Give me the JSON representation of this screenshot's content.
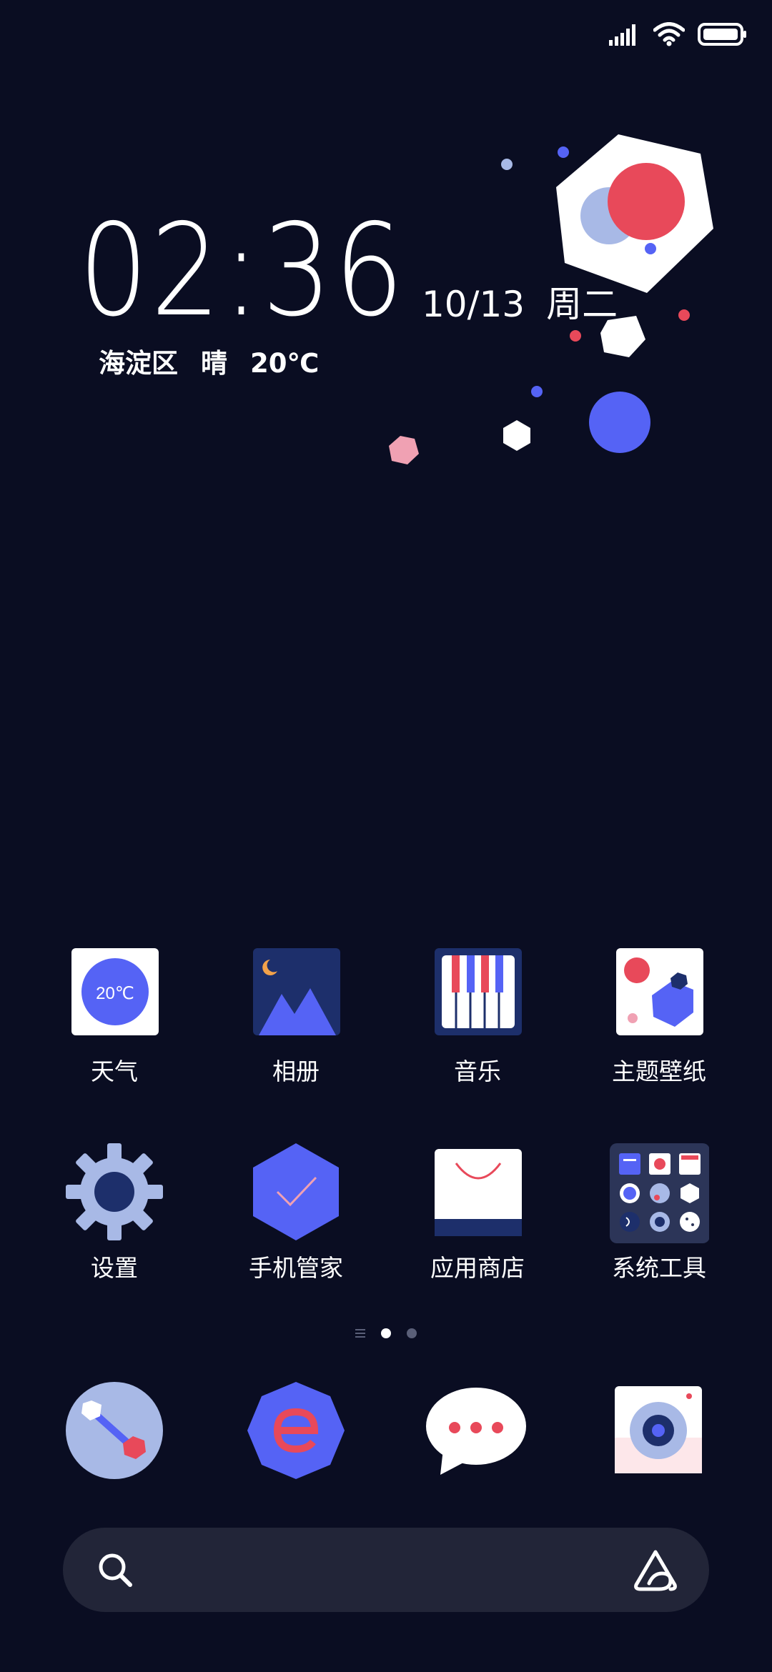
{
  "clock": {
    "time": "02:36",
    "date": "10/13",
    "weekday": "周二",
    "district": "海淀区",
    "condition": "晴",
    "temperature": "20℃"
  },
  "apps": [
    {
      "label": "天气",
      "icon": "weather-icon",
      "badge_text": "20℃"
    },
    {
      "label": "相册",
      "icon": "gallery-icon"
    },
    {
      "label": "音乐",
      "icon": "music-icon"
    },
    {
      "label": "主题壁纸",
      "icon": "themes-icon"
    },
    {
      "label": "设置",
      "icon": "gear-icon"
    },
    {
      "label": "手机管家",
      "icon": "security-icon"
    },
    {
      "label": "应用商店",
      "icon": "app-store-icon"
    },
    {
      "label": "系统工具",
      "icon": "tools-folder-icon"
    }
  ],
  "dock": [
    {
      "icon": "phone-icon"
    },
    {
      "icon": "browser-icon"
    },
    {
      "icon": "messages-icon"
    },
    {
      "icon": "camera-icon"
    }
  ],
  "pager": {
    "pages": 2,
    "active": 1
  },
  "search": {
    "placeholder": ""
  },
  "colors": {
    "background": "#0a0d22",
    "accent_blue": "#5563f5",
    "accent_red": "#e8495a",
    "soft_blue": "#a8b9e6",
    "search_bar": "#222538"
  }
}
